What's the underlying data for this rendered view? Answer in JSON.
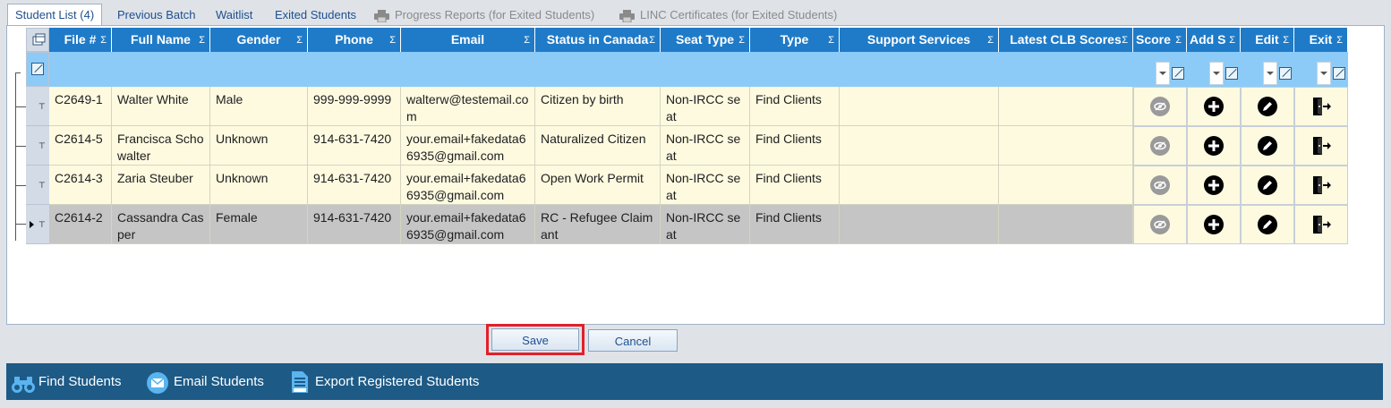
{
  "tabs": [
    {
      "label": "Student List (4)",
      "active": true,
      "disabled": false
    },
    {
      "label": "Previous Batch",
      "active": false,
      "disabled": false
    },
    {
      "label": "Waitlist",
      "active": false,
      "disabled": false
    },
    {
      "label": "Exited Students",
      "active": false,
      "disabled": false
    },
    {
      "label": "Progress Reports (for Exited Students)",
      "active": false,
      "disabled": true,
      "icon": "printer-icon"
    },
    {
      "label": "LINC Certificates (for Exited Students)",
      "active": false,
      "disabled": true,
      "icon": "printer-icon"
    }
  ],
  "grid": {
    "columns": [
      {
        "label": "File #"
      },
      {
        "label": "Full Name"
      },
      {
        "label": "Gender"
      },
      {
        "label": "Phone"
      },
      {
        "label": "Email"
      },
      {
        "label": "Status in Canada"
      },
      {
        "label": "Seat Type"
      },
      {
        "label": "Type"
      },
      {
        "label": "Support Services"
      },
      {
        "label": "Latest CLB Scores"
      },
      {
        "label": "Score"
      },
      {
        "label": "Add S"
      },
      {
        "label": "Edit"
      },
      {
        "label": "Exit"
      }
    ],
    "sigma": "Σ",
    "rows": [
      {
        "file": "C2649-1",
        "name": "Walter White",
        "gender": "Male",
        "phone": "999-999-9999",
        "email": "walterw@testemail.com",
        "status": "Citizen by birth",
        "seat": "Non-IRCC seat",
        "type": "Find Clients",
        "support": "",
        "clb": "",
        "selected": false
      },
      {
        "file": "C2614-5",
        "name": "Francisca Schowalter",
        "gender": "Unknown",
        "phone": "914-631-7420",
        "email": "your.email+fakedata66935@gmail.com",
        "status": "Naturalized Citizen",
        "seat": "Non-IRCC seat",
        "type": "Find Clients",
        "support": "",
        "clb": "",
        "selected": false
      },
      {
        "file": "C2614-3",
        "name": "Zaria Steuber",
        "gender": "Unknown",
        "phone": "914-631-7420",
        "email": "your.email+fakedata66935@gmail.com",
        "status": "Open Work Permit",
        "seat": "Non-IRCC seat",
        "type": "Find Clients",
        "support": "",
        "clb": "",
        "selected": false
      },
      {
        "file": "C2614-2",
        "name": "Cassandra Casper",
        "gender": "Female",
        "phone": "914-631-7420",
        "email": "your.email+fakedata66935@gmail.com",
        "status": "RC - Refugee Claimant",
        "seat": "Non-IRCC seat",
        "type": "Find Clients",
        "support": "",
        "clb": "",
        "selected": true
      }
    ]
  },
  "buttons": {
    "save": "Save",
    "cancel": "Cancel"
  },
  "toolbar": {
    "find": "Find Students",
    "email": "Email Students",
    "export": "Export Registered Students"
  },
  "colors": {
    "header": "#1f7bc8",
    "filter": "#8ccbf7",
    "row": "#fdfae0",
    "selected_row": "#c5c5c5",
    "toolbar": "#1d5a86",
    "highlight": "#e0202a"
  }
}
